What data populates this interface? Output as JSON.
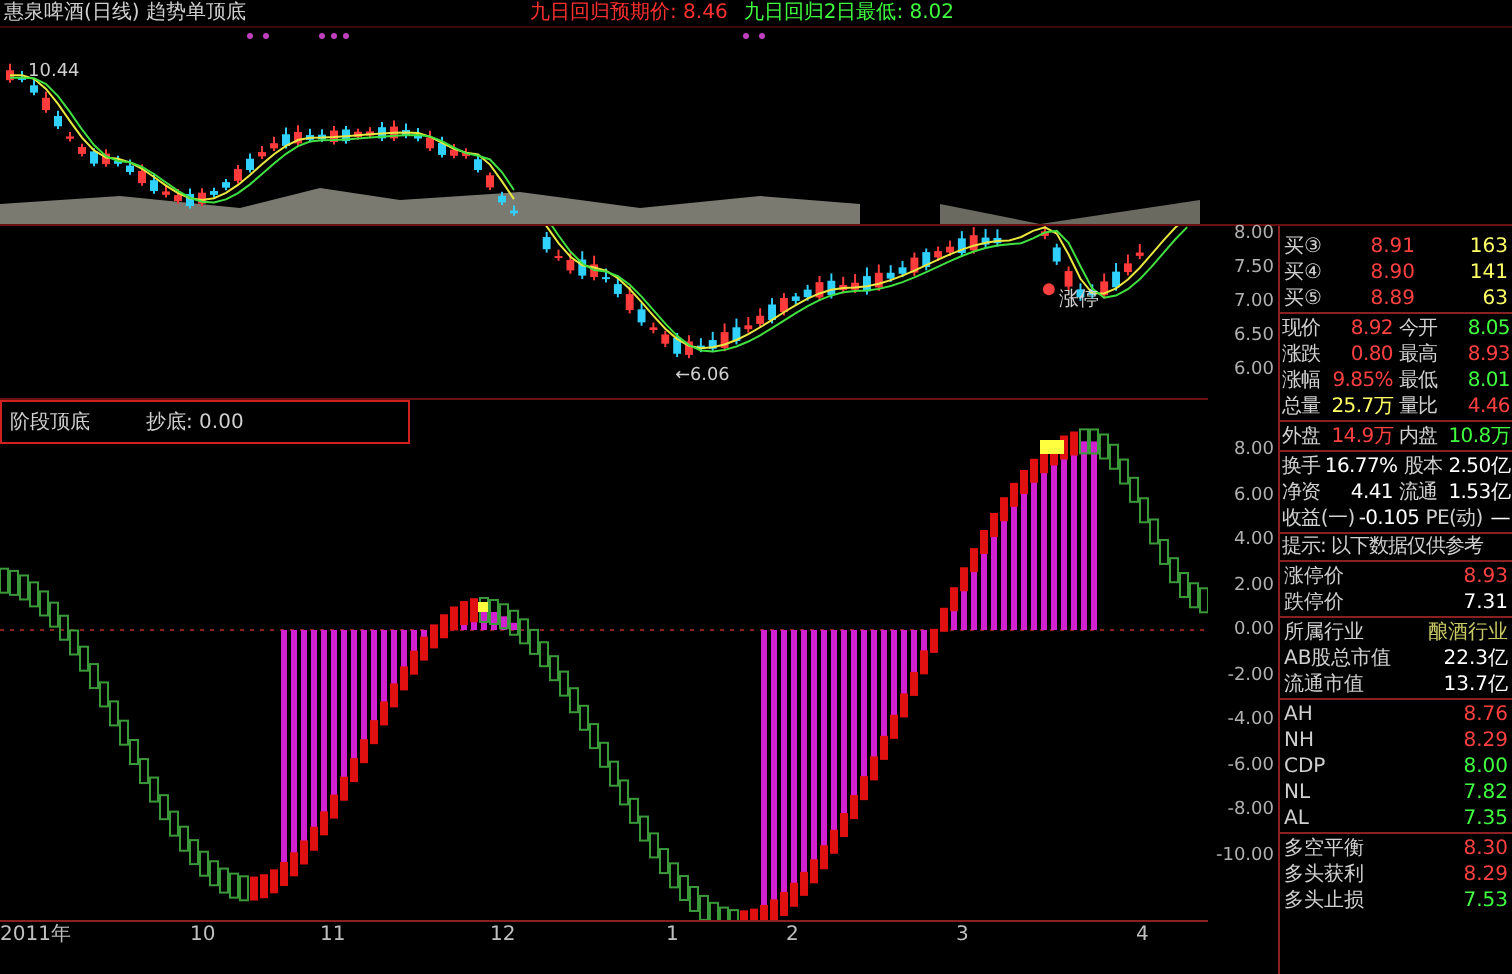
{
  "overlay": {
    "title": "惠泉啤酒(日线) 趋势单顶底",
    "expected_price": "九日回归预期价: 8.46",
    "two_day_low": "九日回归2日最低: 8.02",
    "high_label": "10.44"
  },
  "price_panel": {
    "low_label": "←6.06",
    "limit_up_label": "涨停",
    "yticks": [
      "8.00",
      "7.50",
      "7.00",
      "6.50",
      "6.00"
    ]
  },
  "indicator_panel": {
    "name": "阶段顶底",
    "reading": "抄底: 0.00",
    "yticks": [
      "8.00",
      "6.00",
      "4.00",
      "2.00",
      "0.00",
      "-2.00",
      "-4.00",
      "-6.00",
      "-8.00",
      "-10.00"
    ]
  },
  "x_axis": [
    "2011年",
    "10",
    "11",
    "12",
    "1",
    "2",
    "3",
    "4"
  ],
  "order_book": [
    {
      "label": "买③",
      "price": "8.91",
      "volume": "163"
    },
    {
      "label": "买④",
      "price": "8.90",
      "volume": "141"
    },
    {
      "label": "买⑤",
      "price": "8.89",
      "volume": "63"
    }
  ],
  "quote_groups": [
    [
      [
        {
          "label": "现价",
          "value": "8.92",
          "color": "#ff4040"
        },
        {
          "label": "今开",
          "value": "8.05",
          "color": "#40ff40"
        }
      ],
      [
        {
          "label": "涨跌",
          "value": "0.80",
          "color": "#ff4040"
        },
        {
          "label": "最高",
          "value": "8.93",
          "color": "#ff4040"
        }
      ],
      [
        {
          "label": "涨幅",
          "value": "9.85%",
          "color": "#ff4040"
        },
        {
          "label": "最低",
          "value": "8.01",
          "color": "#40ff40"
        }
      ],
      [
        {
          "label": "总量",
          "value": "25.7万",
          "color": "#ffff66"
        },
        {
          "label": "量比",
          "value": "4.46",
          "color": "#ff4040"
        }
      ]
    ],
    [
      [
        {
          "label": "外盘",
          "value": "14.9万",
          "color": "#ff4040"
        },
        {
          "label": "内盘",
          "value": "10.8万",
          "color": "#40ff40"
        }
      ]
    ],
    [
      [
        {
          "label": "换手",
          "value": "16.77%",
          "color": "#ffffff"
        },
        {
          "label": "股本",
          "value": "2.50亿",
          "color": "#ffffff"
        }
      ],
      [
        {
          "label": "净资",
          "value": "4.41",
          "color": "#ffffff"
        },
        {
          "label": "流通",
          "value": "1.53亿",
          "color": "#ffffff"
        }
      ],
      [
        {
          "label": "收益(一)",
          "value": "-0.105",
          "color": "#ffffff"
        },
        {
          "label": "PE(动)",
          "value": "—",
          "color": "#ffffff"
        }
      ]
    ]
  ],
  "notice": "提示: 以下数据仅供参考",
  "limits": [
    {
      "label": "涨停价",
      "value": "8.93",
      "color": "#ff4040"
    },
    {
      "label": "跌停价",
      "value": "7.31",
      "color": "#ffffff"
    }
  ],
  "market": [
    {
      "label": "所属行业",
      "value": "酿酒行业",
      "color": "#c8c864"
    },
    {
      "label": "AB股总市值",
      "value": "22.3亿",
      "color": "#ffffff"
    },
    {
      "label": "流通市值",
      "value": "13.7亿",
      "color": "#ffffff"
    }
  ],
  "pivots": [
    {
      "label": "AH",
      "value": "8.76",
      "color": "#ff4040"
    },
    {
      "label": "NH",
      "value": "8.29",
      "color": "#ff4040"
    },
    {
      "label": "CDP",
      "value": "8.00",
      "color": "#40ff40"
    },
    {
      "label": "NL",
      "value": "7.82",
      "color": "#40ff40"
    },
    {
      "label": "AL",
      "value": "7.35",
      "color": "#40ff40"
    }
  ],
  "balance": [
    {
      "label": "多空平衡",
      "value": "8.30",
      "color": "#ff4040"
    },
    {
      "label": "多头获利",
      "value": "8.29",
      "color": "#ff4040"
    },
    {
      "label": "多头止损",
      "value": "7.53",
      "color": "#40ff40"
    }
  ]
}
